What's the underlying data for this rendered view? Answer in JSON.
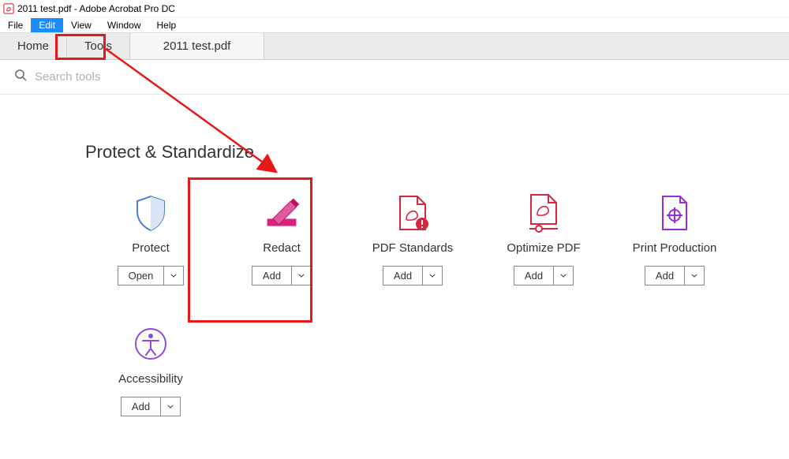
{
  "window": {
    "title": "2011 test.pdf - Adobe Acrobat Pro DC"
  },
  "menu": {
    "file": "File",
    "edit": "Edit",
    "view": "View",
    "window": "Window",
    "help": "Help"
  },
  "tabs": {
    "home": "Home",
    "tools": "Tools",
    "document": "2011 test.pdf"
  },
  "search": {
    "placeholder": "Search tools"
  },
  "section": {
    "title": "Protect & Standardize"
  },
  "tools": {
    "protect": {
      "label": "Protect",
      "button": "Open"
    },
    "redact": {
      "label": "Redact",
      "button": "Add"
    },
    "pdfstandards": {
      "label": "PDF Standards",
      "button": "Add"
    },
    "optimize": {
      "label": "Optimize PDF",
      "button": "Add"
    },
    "printprod": {
      "label": "Print Production",
      "button": "Add"
    },
    "accessibility": {
      "label": "Accessibility",
      "button": "Add"
    }
  },
  "colors": {
    "annotation": "#e71818",
    "edit_highlight": "#1d8cff"
  }
}
